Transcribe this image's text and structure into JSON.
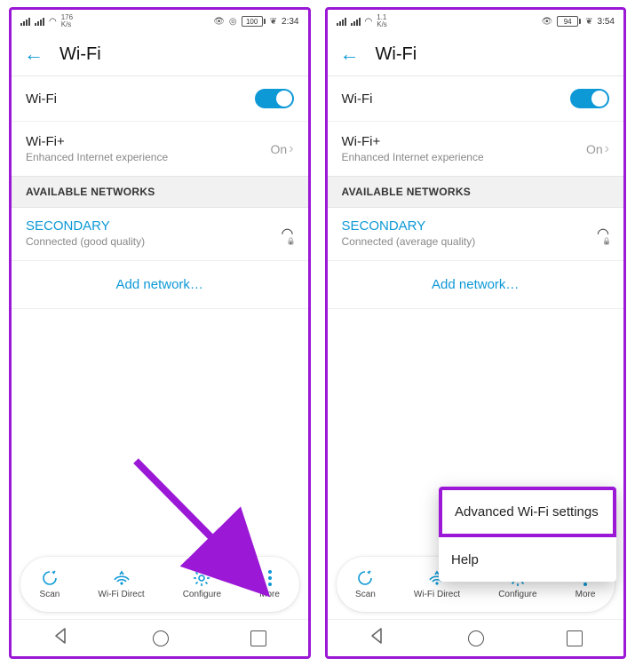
{
  "phone1": {
    "status": {
      "kbps_top": "176",
      "kbps_unit": "K/s",
      "battery": "100",
      "time": "2:34"
    },
    "title": "Wi-Fi",
    "wifi_label": "Wi-Fi",
    "wifiplus": {
      "label": "Wi-Fi+",
      "sub": "Enhanced Internet experience",
      "value": "On"
    },
    "section": "AVAILABLE NETWORKS",
    "net": {
      "name": "SECONDARY",
      "sub": "Connected (good quality)"
    },
    "addnet": "Add network…",
    "bb": {
      "scan": "Scan",
      "direct": "Wi-Fi Direct",
      "configure": "Configure",
      "more": "More"
    }
  },
  "phone2": {
    "status": {
      "kbps_top": "1.1",
      "kbps_unit": "K/s",
      "battery": "94",
      "time": "3:54"
    },
    "title": "Wi-Fi",
    "wifi_label": "Wi-Fi",
    "wifiplus": {
      "label": "Wi-Fi+",
      "sub": "Enhanced Internet experience",
      "value": "On"
    },
    "section": "AVAILABLE NETWORKS",
    "net": {
      "name": "SECONDARY",
      "sub": "Connected (average quality)"
    },
    "addnet": "Add network…",
    "bb": {
      "scan": "Scan",
      "direct": "Wi-Fi Direct",
      "configure": "Configure",
      "more": "More"
    },
    "popup": {
      "advanced": "Advanced Wi-Fi settings",
      "help": "Help"
    }
  }
}
